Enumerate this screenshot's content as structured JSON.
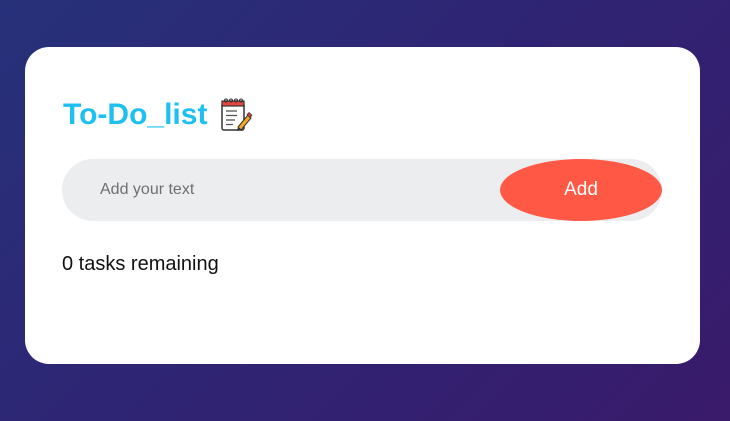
{
  "app": {
    "title": "To-Do_list",
    "title_icon": "notepad-icon"
  },
  "input": {
    "placeholder": "Add your text",
    "value": ""
  },
  "add_button": {
    "label": "Add"
  },
  "status": {
    "remaining_text": "0 tasks remaining"
  },
  "colors": {
    "accent": "#1ec0f0",
    "button": "#ff5945",
    "input_bg": "#ecedef",
    "card_bg": "#ffffff",
    "background_start": "#27317a",
    "background_end": "#3a1a6b"
  }
}
